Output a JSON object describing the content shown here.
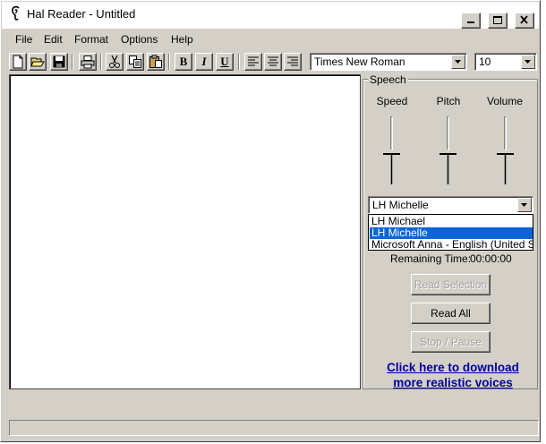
{
  "window": {
    "title": "Hal Reader - Untitled",
    "icon": "ear-icon"
  },
  "menu": [
    "File",
    "Edit",
    "Format",
    "Options",
    "Help"
  ],
  "toolbar": {
    "bold_label": "B",
    "italic_label": "I",
    "underline_label": "U",
    "font_name": "Times New Roman",
    "font_size": "10"
  },
  "speech": {
    "group_label": "Speech",
    "sliders": [
      {
        "label": "Speed"
      },
      {
        "label": "Pitch"
      },
      {
        "label": "Volume"
      }
    ],
    "voice_selected": "LH Michelle",
    "voice_options": [
      "LH Michael",
      "LH Michelle",
      "Microsoft Anna - English (United States)"
    ],
    "remaining_label": "Remaining Time:",
    "remaining_value": "00:00:00",
    "buttons": {
      "read_selection": "Read Selection",
      "read_all": "Read All",
      "stop_pause": "Stop / Pause"
    },
    "download_line1": "Click here to download",
    "download_line2": "more realistic voices"
  }
}
